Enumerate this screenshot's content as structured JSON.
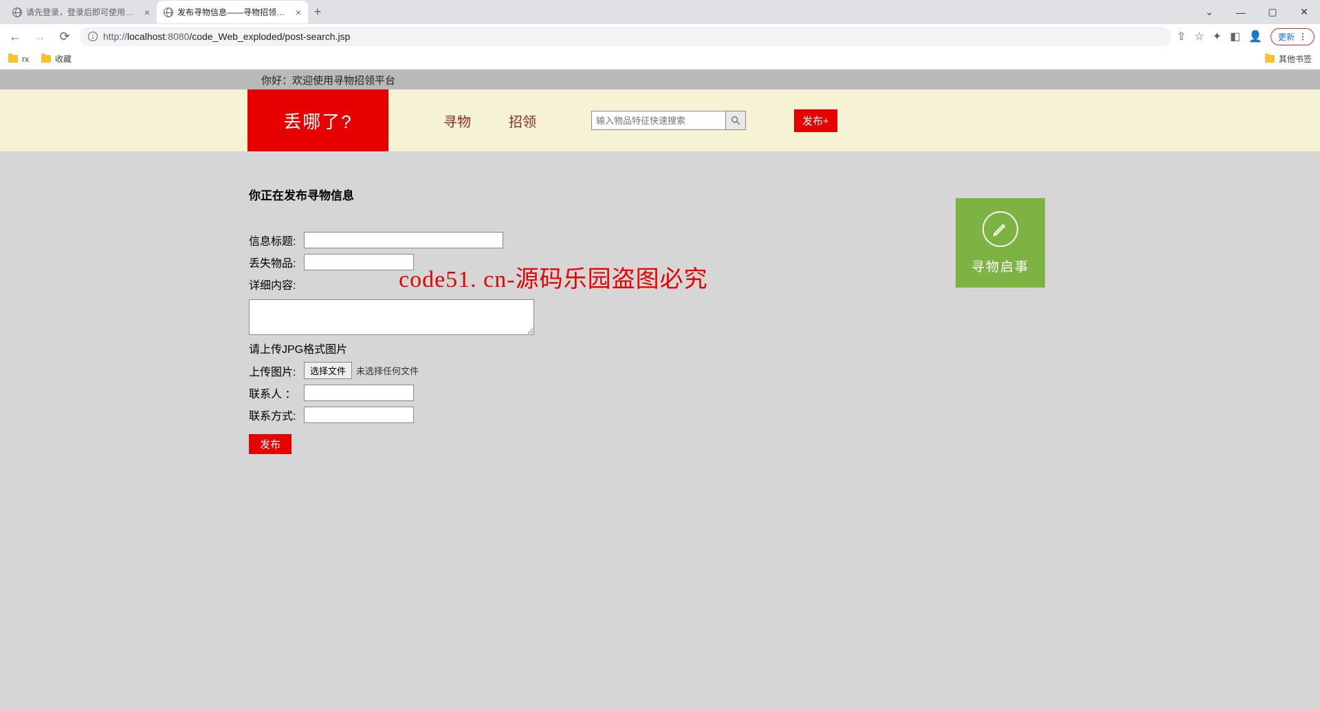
{
  "browser": {
    "tabs": [
      {
        "title": "请先登录，登录后即可使用寻物招…"
      },
      {
        "title": "发布寻物信息——寻物招领平台"
      }
    ],
    "url_prefix": "http://",
    "url_host": "localhost",
    "url_port": ":8080",
    "url_path": "/code_Web_exploded/post-search.jsp",
    "update_label": "更新",
    "bookmarks": [
      {
        "label": "rx"
      },
      {
        "label": "收藏"
      }
    ],
    "other_bookmarks": "其他书签"
  },
  "page": {
    "greeting": "你好：欢迎使用寻物招领平台",
    "logo": "丢哪了?",
    "nav": {
      "search": "寻物",
      "claim": "招领"
    },
    "search_placeholder": "输入物品特征快速搜索",
    "publish_btn": "发布+",
    "form_title": "你正在发布寻物信息",
    "labels": {
      "title": "信息标题:",
      "item": "丢失物品:",
      "detail": "详细内容:",
      "upload_hint": "请上传JPG格式图片",
      "upload": "上传图片:",
      "file_btn": "选择文件",
      "file_status": "未选择任何文件",
      "contact_person": "联系人 ：",
      "contact_info": "联系方式:",
      "submit": "发布"
    },
    "side_card": "寻物启事",
    "watermark": "code51. cn-源码乐园盗图必究"
  }
}
